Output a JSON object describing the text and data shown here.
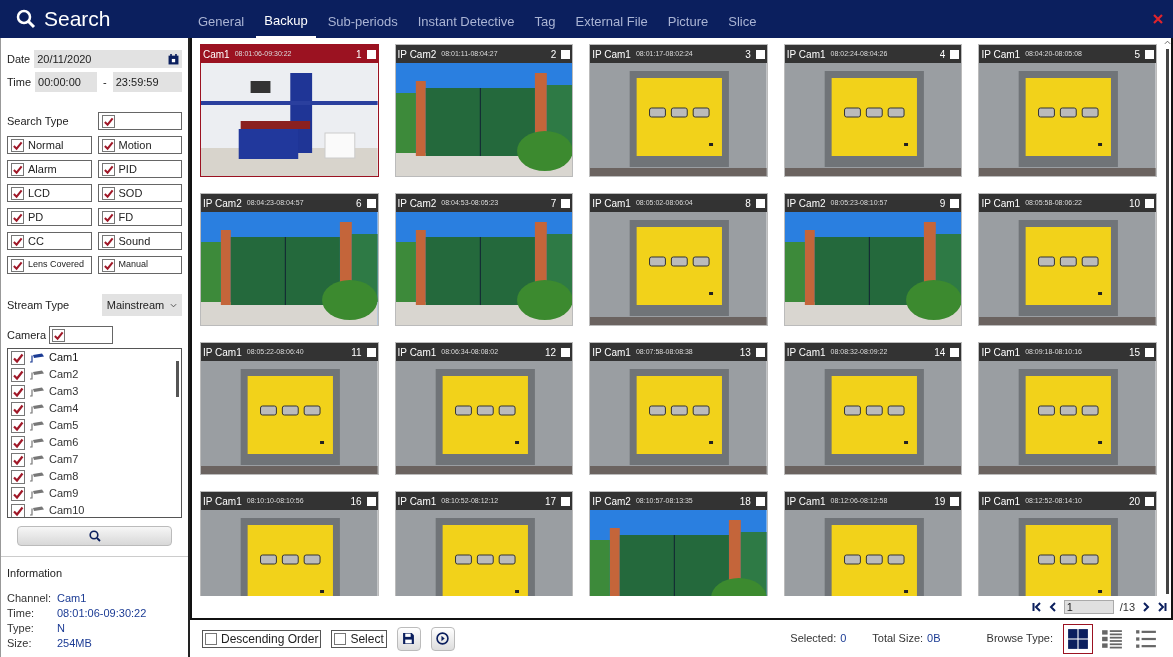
{
  "window": {
    "title": "Search"
  },
  "tabs": [
    {
      "label": "General",
      "selected": false
    },
    {
      "label": "Backup",
      "selected": true
    },
    {
      "label": "Sub-periods",
      "selected": false
    },
    {
      "label": "Instant Detective",
      "selected": false
    },
    {
      "label": "Tag",
      "selected": false
    },
    {
      "label": "External File",
      "selected": false
    },
    {
      "label": "Picture",
      "selected": false
    },
    {
      "label": "Slice",
      "selected": false
    }
  ],
  "date": {
    "label": "Date",
    "value": "20/11/2020"
  },
  "time": {
    "label": "Time",
    "start": "00:00:00",
    "separator": "-",
    "end": "23:59:59"
  },
  "search_type": {
    "label": "Search Type",
    "checked": true,
    "options": [
      {
        "label": "Normal",
        "checked": true
      },
      {
        "label": "Motion",
        "checked": true
      },
      {
        "label": "Alarm",
        "checked": true
      },
      {
        "label": "PID",
        "checked": true
      },
      {
        "label": "LCD",
        "checked": true
      },
      {
        "label": "SOD",
        "checked": true
      },
      {
        "label": "PD",
        "checked": true
      },
      {
        "label": "FD",
        "checked": true
      },
      {
        "label": "CC",
        "checked": true
      },
      {
        "label": "Sound",
        "checked": true
      },
      {
        "label": "Lens Covered",
        "checked": true
      },
      {
        "label": "Manual",
        "checked": true
      }
    ]
  },
  "stream_type": {
    "label": "Stream Type",
    "value": "Mainstream"
  },
  "camera": {
    "label": "Camera",
    "checked": true,
    "items": [
      {
        "name": "Cam1",
        "checked": true,
        "selected": true
      },
      {
        "name": "Cam2",
        "checked": true,
        "selected": false
      },
      {
        "name": "Cam3",
        "checked": true,
        "selected": false
      },
      {
        "name": "Cam4",
        "checked": true,
        "selected": false
      },
      {
        "name": "Cam5",
        "checked": true,
        "selected": false
      },
      {
        "name": "Cam6",
        "checked": true,
        "selected": false
      },
      {
        "name": "Cam7",
        "checked": true,
        "selected": false
      },
      {
        "name": "Cam8",
        "checked": true,
        "selected": false
      },
      {
        "name": "Cam9",
        "checked": true,
        "selected": false
      },
      {
        "name": "Cam10",
        "checked": true,
        "selected": false
      }
    ]
  },
  "information": {
    "title": "Information",
    "fields": [
      {
        "label": "Channel:",
        "value": "Cam1"
      },
      {
        "label": "Time:",
        "value": "08:01:06-09:30:22"
      },
      {
        "label": "Type:",
        "value": "N"
      },
      {
        "label": "Size:",
        "value": "254MB"
      }
    ]
  },
  "thumbnails": [
    {
      "camera": "Cam1",
      "time": "08:01:06-09:30:22",
      "number": "1",
      "checked": false,
      "selected": true,
      "kind": "office"
    },
    {
      "camera": "IP Cam2",
      "time": "08:01:11-08:04:27",
      "number": "2",
      "checked": false,
      "selected": false,
      "kind": "gate"
    },
    {
      "camera": "IP Cam1",
      "time": "08:01:17-08:02:24",
      "number": "3",
      "checked": false,
      "selected": false,
      "kind": "door"
    },
    {
      "camera": "IP Cam1",
      "time": "08:02:24-08:04:26",
      "number": "4",
      "checked": false,
      "selected": false,
      "kind": "door"
    },
    {
      "camera": "IP Cam1",
      "time": "08:04:20-08:05:08",
      "number": "5",
      "checked": false,
      "selected": false,
      "kind": "door"
    },
    {
      "camera": "IP Cam2",
      "time": "08:04:23-08:04:57",
      "number": "6",
      "checked": false,
      "selected": false,
      "kind": "gate"
    },
    {
      "camera": "IP Cam2",
      "time": "08:04:53-08:05:23",
      "number": "7",
      "checked": false,
      "selected": false,
      "kind": "gate"
    },
    {
      "camera": "IP Cam1",
      "time": "08:05:02-08:06:04",
      "number": "8",
      "checked": false,
      "selected": false,
      "kind": "door"
    },
    {
      "camera": "IP Cam2",
      "time": "08:05:23-08:10:57",
      "number": "9",
      "checked": false,
      "selected": false,
      "kind": "gate"
    },
    {
      "camera": "IP Cam1",
      "time": "08:05:58-08:06:22",
      "number": "10",
      "checked": false,
      "selected": false,
      "kind": "door"
    },
    {
      "camera": "IP Cam1",
      "time": "08:05:22-08:06:40",
      "number": "11",
      "checked": false,
      "selected": false,
      "kind": "door"
    },
    {
      "camera": "IP Cam1",
      "time": "08:06:34-08:08:02",
      "number": "12",
      "checked": false,
      "selected": false,
      "kind": "door"
    },
    {
      "camera": "IP Cam1",
      "time": "08:07:58-08:08:38",
      "number": "13",
      "checked": false,
      "selected": false,
      "kind": "door"
    },
    {
      "camera": "IP Cam1",
      "time": "08:08:32-08:09:22",
      "number": "14",
      "checked": false,
      "selected": false,
      "kind": "door"
    },
    {
      "camera": "IP Cam1",
      "time": "08:09:18-08:10:16",
      "number": "15",
      "checked": false,
      "selected": false,
      "kind": "door"
    },
    {
      "camera": "IP Cam1",
      "time": "08:10:10-08:10:56",
      "number": "16",
      "checked": false,
      "selected": false,
      "kind": "door"
    },
    {
      "camera": "IP Cam1",
      "time": "08:10:52-08:12:12",
      "number": "17",
      "checked": false,
      "selected": false,
      "kind": "door"
    },
    {
      "camera": "IP Cam2",
      "time": "08:10:57-08:13:35",
      "number": "18",
      "checked": false,
      "selected": false,
      "kind": "gate"
    },
    {
      "camera": "IP Cam1",
      "time": "08:12:06-08:12:58",
      "number": "19",
      "checked": false,
      "selected": false,
      "kind": "door"
    },
    {
      "camera": "IP Cam1",
      "time": "08:12:52-08:14:10",
      "number": "20",
      "checked": false,
      "selected": false,
      "kind": "door"
    }
  ],
  "pagination": {
    "page": "1",
    "total": "/13"
  },
  "footer": {
    "descending_order": {
      "label": "Descending Order",
      "checked": false
    },
    "select": {
      "label": "Select",
      "checked": false
    },
    "selected": {
      "label": "Selected:",
      "value": "0"
    },
    "total_size": {
      "label": "Total Size:",
      "value": "0B"
    },
    "browse_type": {
      "label": "Browse Type:",
      "options": [
        {
          "kind": "thumbnail",
          "selected": true
        },
        {
          "kind": "detail",
          "selected": false
        },
        {
          "kind": "list",
          "selected": false
        }
      ]
    }
  }
}
